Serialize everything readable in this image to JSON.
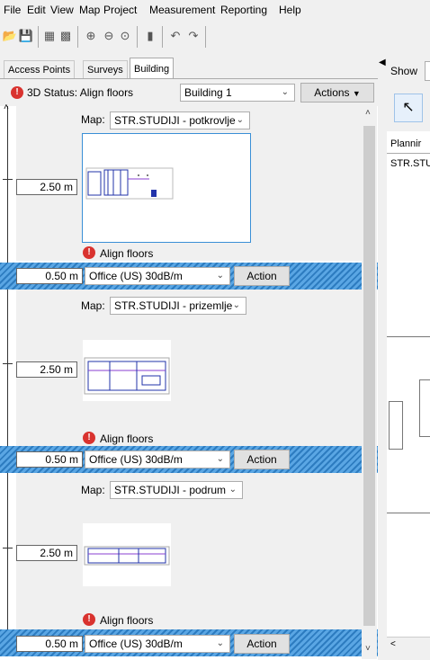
{
  "menu": [
    "File",
    "Edit",
    "View",
    "Map",
    "Project",
    "Measurement",
    "Reporting",
    "Help"
  ],
  "toolbar_icons": [
    "open-folder-icon",
    "save-icon",
    "grid-icon",
    "export-icon",
    "zoom-in-icon",
    "zoom-out-icon",
    "zoom-fit-icon",
    "chart-icon",
    "undo-icon",
    "redo-icon"
  ],
  "tabs": [
    "Access Points",
    "Surveys",
    "Building"
  ],
  "active_tab": "Building",
  "status": {
    "label": "3D Status: Align floors",
    "building": "Building 1",
    "actions": "Actions"
  },
  "floors": [
    {
      "map_label": "Map:",
      "map": "STR.STUDIJI - potkrovlje",
      "height": "2.50 m",
      "align": "Align floors",
      "selected": true
    },
    {
      "map_label": "Map:",
      "map": "STR.STUDIJI - prizemlje",
      "height": "2.50 m",
      "align": "Align floors",
      "selected": false
    },
    {
      "map_label": "Map:",
      "map": "STR.STUDIJI - podrum",
      "height": "2.50 m",
      "align": "Align floors",
      "selected": false
    }
  ],
  "bands": [
    {
      "thickness": "0.50 m",
      "material": "Office (US) 30dB/m",
      "action": "Action"
    },
    {
      "thickness": "0.50 m",
      "material": "Office (US) 30dB/m",
      "action": "Action"
    },
    {
      "thickness": "0.50 m",
      "material": "Office (US) 30dB/m",
      "action": "Action"
    }
  ],
  "right_panel": {
    "show_label": "Show",
    "planning_label": "Plannir",
    "map_label": "STR.STU"
  },
  "colors": {
    "accent": "#2d7cc0",
    "warning": "#d9332f",
    "select_border": "#3a8fd6"
  }
}
